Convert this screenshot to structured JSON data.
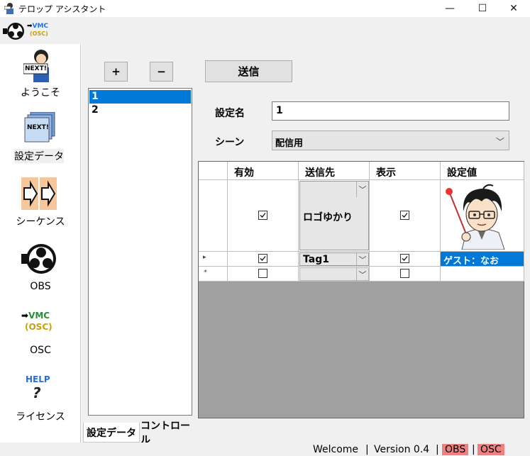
{
  "window": {
    "title": "テロップ アシスタント",
    "minimize_glyph": "—",
    "maximize_glyph": "☐",
    "close_glyph": "✕"
  },
  "toolbar": {
    "vmc_label": "VMC",
    "osc_label": "(OSC)"
  },
  "sidebar": {
    "items": [
      {
        "label": "ようこそ",
        "icon": "next-person-icon"
      },
      {
        "label": "設定データ",
        "icon": "next-stack-icon"
      },
      {
        "label": "シーケンス",
        "icon": "sequence-arrows-icon"
      },
      {
        "label": "OBS",
        "icon": "obs-icon"
      },
      {
        "label": "OSC",
        "icon": "vmc-osc-icon"
      },
      {
        "label": "ライセンス",
        "icon": "help-icon"
      }
    ],
    "next_badge": "NEXT!",
    "help_badge": "HELP",
    "help_mark": "?"
  },
  "controls": {
    "add_label": "+",
    "remove_label": "−",
    "send_label": "送信"
  },
  "list": {
    "items": [
      "1",
      "2"
    ],
    "selected_index": 0
  },
  "form": {
    "name_label": "設定名",
    "name_value": "1",
    "scene_label": "シーン",
    "scene_value": "配信用"
  },
  "grid": {
    "headers": [
      "有効",
      "送信先",
      "表示",
      "設定値"
    ],
    "rows": [
      {
        "enabled": true,
        "target": "ロゴゆかり",
        "visible": true,
        "value": "character-image"
      },
      {
        "enabled": true,
        "target": "Tag1",
        "visible": true,
        "value": "ゲスト：なお"
      },
      {
        "enabled": false,
        "target": "",
        "visible": false,
        "value": ""
      }
    ],
    "new_row_marker": "*",
    "current_row_marker": "▸"
  },
  "tabs": {
    "items": [
      "設定データ",
      "コントロール"
    ],
    "active_index": 0
  },
  "status": {
    "welcome": "Welcome",
    "sep": "|",
    "version": "Version 0.4",
    "obs": "OBS",
    "osc": "OSC"
  },
  "colors": {
    "selection": "#0078d7",
    "badge": "#f08080",
    "grid_bg": "#a0a0a0"
  }
}
